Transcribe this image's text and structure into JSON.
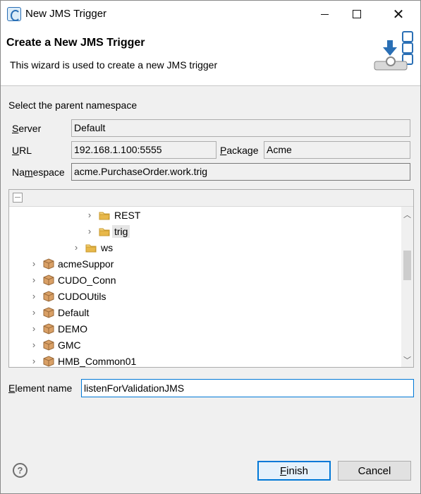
{
  "window": {
    "title": "New JMS Trigger",
    "minimize_label": "—",
    "close_label": "✕"
  },
  "header": {
    "title": "Create a New JMS Trigger",
    "description": "This wizard is used to create a new JMS trigger"
  },
  "form": {
    "section_label": "Select the parent namespace",
    "server_label_first": "S",
    "server_label_rest": "erver",
    "server_value": "Default",
    "url_label_first": "U",
    "url_label_rest": "RL",
    "url_value": "192.168.1.100:5555",
    "package_label_first": "P",
    "package_label_rest": "ackage",
    "package_value": "Acme",
    "namespace_label_pre": "Na",
    "namespace_label_u": "m",
    "namespace_label_post": "espace",
    "namespace_value": "acme.PurchaseOrder.work.trig"
  },
  "tree": {
    "rows": [
      {
        "label": "REST",
        "type": "folder",
        "chevron": "›"
      },
      {
        "label": "trig",
        "type": "folder",
        "chevron": "›",
        "selected": true
      },
      {
        "label": "ws",
        "type": "folder",
        "chevron": "›"
      },
      {
        "label": "acmeSuppor",
        "type": "package",
        "chevron": "›"
      },
      {
        "label": "CUDO_Conn",
        "type": "package",
        "chevron": "›"
      },
      {
        "label": "CUDOUtils",
        "type": "package",
        "chevron": "›"
      },
      {
        "label": "Default",
        "type": "package",
        "chevron": "›"
      },
      {
        "label": "DEMO",
        "type": "package",
        "chevron": "›"
      },
      {
        "label": "GMC",
        "type": "package",
        "chevron": "›"
      },
      {
        "label": "HMB_Common01",
        "type": "package",
        "chevron": "›"
      }
    ],
    "scroll_up": "︿",
    "scroll_down": "﹀"
  },
  "element": {
    "label_first": "E",
    "label_rest": "lement name",
    "value": "listenForValidationJMS"
  },
  "footer": {
    "help": "?",
    "finish_first": "F",
    "finish_rest": "inish",
    "cancel": "Cancel"
  },
  "colors": {
    "accent": "#0078d7",
    "folder": "#e8b84a",
    "package": "#c98a4b"
  }
}
